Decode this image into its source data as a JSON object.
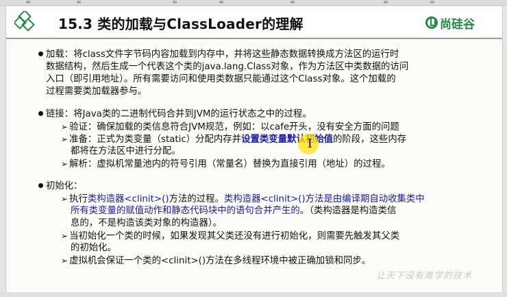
{
  "slide": {
    "title": "15.3 类的加载与ClassLoader的理解",
    "logo": "尚硅谷",
    "watermark": "让天下没有难学的技术"
  },
  "content": {
    "load": {
      "lines": [
        "加载：将class文件字节码内容加载到内存中，并将这些静态数据转换成方法区的运行时",
        "数据结构，然后生成一个代表这个类的java.lang.Class对象，作为方法区中类数据的访问",
        "入口（即引用地址）。所有需要访问和使用类数据只能通过这个Class对象。这个加载的",
        "过程需要类加载器参与。"
      ]
    },
    "link": {
      "head": "链接：将Java类的二进制代码合并到JVM的运行状态之中的过程。",
      "verify": "验证：确保加载的类信息符合JVM规范，例如：以cafe开头，没有安全方面的问题",
      "prepare_before": "准备：正式为类变量（static）分配内存并",
      "prepare_blue": "设置类变量默认初始值",
      "prepare_after": "的阶段，这些内存",
      "prepare_line2": "都将在方法区中进行分配。",
      "resolve": "解析：虚拟机常量池内的符号引用（常量名）替换为直接引用（地址）的过程。"
    },
    "init": {
      "head": "初始化：",
      "l1_prefix": "执行",
      "l1_blue1": "类构造器<clinit>()",
      "l1_mid": "方法的过程。",
      "l1_blue2": "类构造器<clinit>()方法是由编译期自动收集类中",
      "l2_blue": "所有类变量的赋值动作和静态代码块中的语句合并产生的",
      "l2_after": "。（类构造器是构造类信",
      "l3": "息的，不是构造该类对象的构造器）。",
      "l4": "当初始化一个类的时候，如果发现其父类还没有进行初始化，则需要先触发其父类",
      "l5": "的初始化。",
      "l6": "虚拟机会保证一个类的<clinit>()方法在多线程环境中被正确加锁和同步。"
    }
  },
  "colors": {
    "accent_blue": "#1a1aa8",
    "logo_green": "#1e8e3e"
  }
}
